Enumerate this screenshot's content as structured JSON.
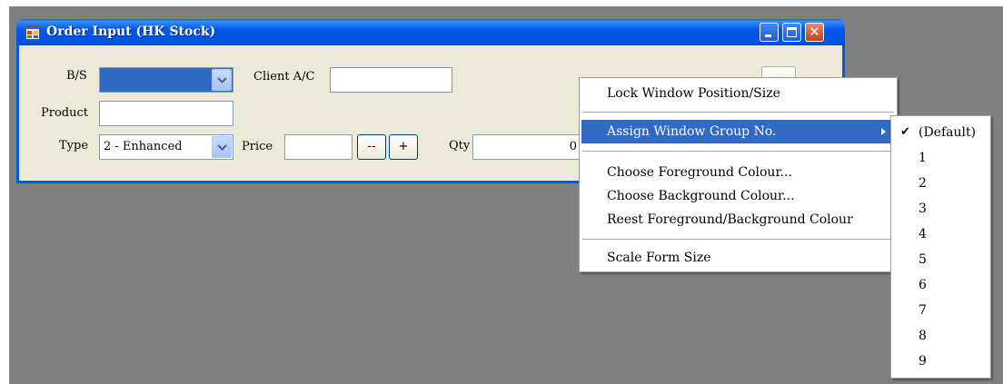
{
  "window": {
    "title": "Order Input (HK Stock)"
  },
  "form": {
    "bs_label": "B/S",
    "bs_value": "",
    "client_label": "Client A/C",
    "client_value": "",
    "product_label": "Product",
    "product_value": "",
    "type_label": "Type",
    "type_value": "2 - Enhanced",
    "price_label": "Price",
    "price_value": "",
    "price_down_label": "--",
    "price_up_label": "+",
    "qty_label": "Qty",
    "qty_value": "0"
  },
  "context_menu": {
    "items": [
      {
        "label": "Lock Window Position/Size"
      },
      {
        "label": "Assign Window Group No."
      },
      {
        "label": "Choose Foreground Colour..."
      },
      {
        "label": "Choose Background Colour..."
      },
      {
        "label": "Reest Foreground/Background Colour"
      },
      {
        "label": "Scale Form Size"
      }
    ],
    "highlight_color": "#316ac5"
  },
  "submenu": {
    "items": [
      {
        "label": "(Default)",
        "checked": true
      },
      {
        "label": "1"
      },
      {
        "label": "2"
      },
      {
        "label": "3"
      },
      {
        "label": "4"
      },
      {
        "label": "5"
      },
      {
        "label": "6"
      },
      {
        "label": "7"
      },
      {
        "label": "8"
      },
      {
        "label": "9"
      }
    ]
  },
  "colors": {
    "titlebar": "#0054e3",
    "window_face": "#ece9d8",
    "desktop": "#808080",
    "selection": "#316ac5"
  }
}
